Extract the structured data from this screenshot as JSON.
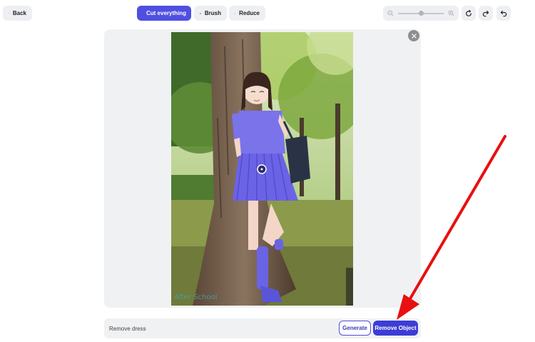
{
  "toolbar": {
    "back_label": "Back",
    "cut_label": "Cut everything",
    "brush_label": "Brush",
    "reduce_label": "Reduce"
  },
  "zoom": {
    "level": 0.5
  },
  "canvas": {
    "watermark": "After School"
  },
  "prompt": {
    "value": "Remove dress",
    "generate_label": "Generate",
    "remove_label": "Remove Object"
  },
  "colors": {
    "accent": "#4f4fe0",
    "selection": "#6b63e6",
    "arrow": "#e81010"
  }
}
